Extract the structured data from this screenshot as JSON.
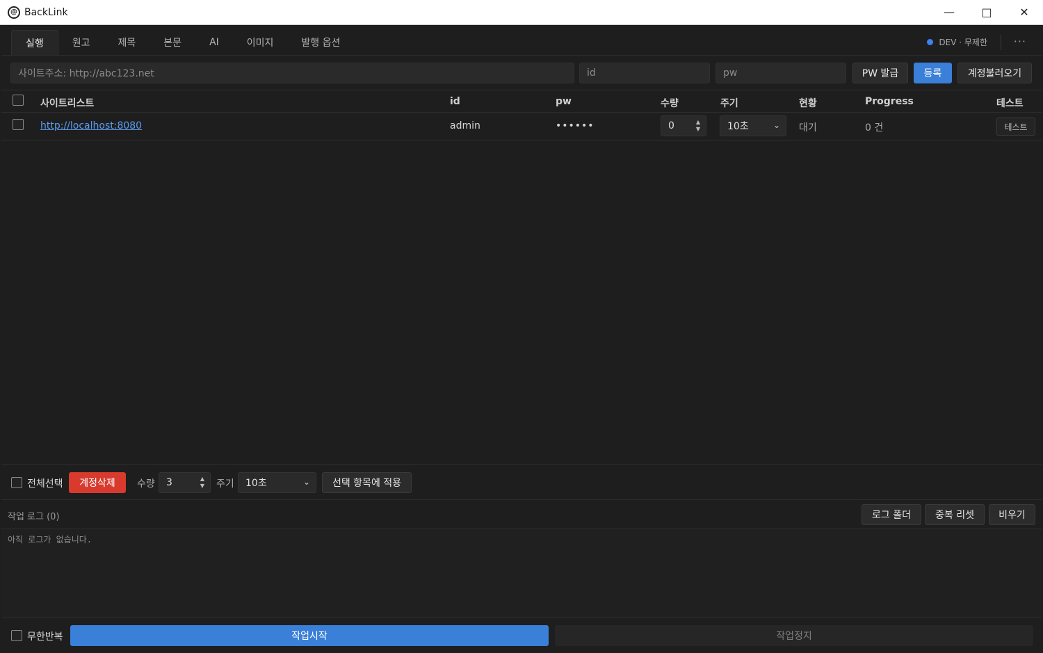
{
  "window": {
    "title": "BackLink",
    "app_icon": "at-sign-logo"
  },
  "tabs": [
    "실행",
    "원고",
    "제목",
    "본문",
    "AI",
    "이미지",
    "발행 옵션"
  ],
  "status": {
    "label": "DEV · 무제한",
    "dot_color": "#3b82f6"
  },
  "more_label": "···",
  "inputs": {
    "site_placeholder": "사이트주소: http://abc123.net",
    "id_placeholder": "id",
    "pw_placeholder": "pw"
  },
  "buttons": {
    "pw_issue": "PW 발급",
    "register": "등록",
    "load_accounts": "계정불러오기",
    "delete_accounts": "계정삭제",
    "apply_selected": "선택 항목에 적용",
    "log_folder": "로그 폴더",
    "dedupe_reset": "중복 리셋",
    "clear": "비우기",
    "start": "작업시작",
    "stop": "작업정지"
  },
  "table": {
    "headers": {
      "site": "사이트리스트",
      "id": "id",
      "pw": "pw",
      "qty": "수량",
      "period": "주기",
      "status": "현황",
      "progress": "Progress",
      "test": "테스트"
    },
    "rows": [
      {
        "site": "http://localhost:8080",
        "id": "admin",
        "pw": "••••••",
        "qty": "0",
        "period": "10초",
        "status": "대기",
        "progress": "0 건",
        "test": "테스트"
      }
    ]
  },
  "bulk": {
    "select_all": "전체선택",
    "qty_label": "수량",
    "qty_value": "3",
    "period_label": "주기",
    "period_value": "10초"
  },
  "log": {
    "title": "작업 로그 (0)",
    "empty": "아직 로그가 없습니다."
  },
  "footer": {
    "infinite_repeat": "무한반복"
  },
  "colors": {
    "accent": "#3a7fd8",
    "danger": "#d83a2e",
    "background": "#1e1e1e"
  }
}
